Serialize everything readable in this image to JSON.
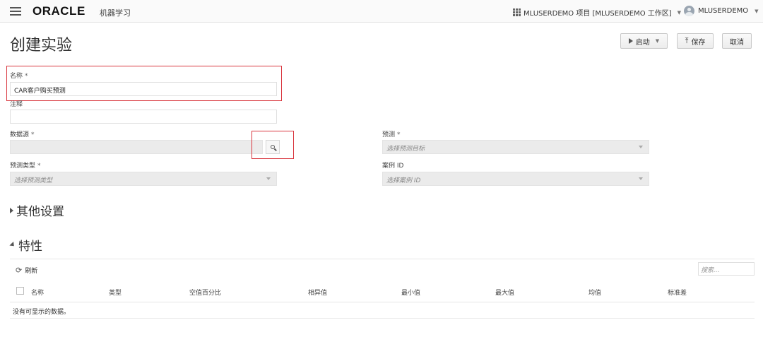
{
  "header": {
    "logo": "ORACLE",
    "app_title": "机器学习",
    "project": "MLUSERDEMO 项目 [MLUSERDEMO 工作区]",
    "user": "MLUSERDEMO"
  },
  "page": {
    "title": "创建实验",
    "actions": {
      "start": "启动",
      "save": "保存",
      "cancel": "取消"
    }
  },
  "form": {
    "name": {
      "label": "名称",
      "required": "*",
      "value": "CAR客户购买预测"
    },
    "comment": {
      "label": "注释",
      "value": ""
    },
    "data_source": {
      "label": "数据源",
      "required": "*",
      "value": ""
    },
    "predict": {
      "label": "预测",
      "required": "*",
      "placeholder": "选择预测目标"
    },
    "prediction_type": {
      "label": "预测类型",
      "required": "*",
      "placeholder": "选择预测类型"
    },
    "case_id": {
      "label": "案例 ID",
      "placeholder": "选择案例 ID"
    }
  },
  "sections": {
    "other_settings": "其他设置",
    "features": "特性"
  },
  "features_table": {
    "refresh": "刷新",
    "search_placeholder": "搜索...",
    "columns": [
      "名称",
      "类型",
      "空值百分比",
      "相异值",
      "最小值",
      "最大值",
      "均值",
      "标准差"
    ],
    "empty_message": "没有可显示的数据。"
  },
  "colors": {
    "highlight": "#d9363e"
  },
  "icons": [
    "menu-icon",
    "grid-icon",
    "chevron-down-icon",
    "user-icon",
    "play-icon",
    "upload-icon",
    "search-icon",
    "refresh-icon",
    "triangle-right-icon",
    "triangle-down-icon"
  ]
}
